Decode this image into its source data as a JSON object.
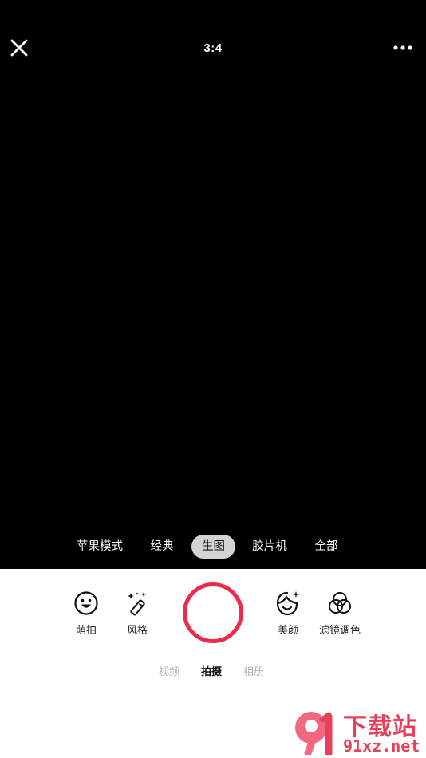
{
  "top_bar": {
    "ratio_label": "3:4"
  },
  "style_tabs": [
    {
      "label": "苹果模式",
      "active": false
    },
    {
      "label": "经典",
      "active": false
    },
    {
      "label": "生图",
      "active": true
    },
    {
      "label": "胶片机",
      "active": false
    },
    {
      "label": "全部",
      "active": false
    }
  ],
  "tools": {
    "cute": {
      "label": "萌拍",
      "icon": "smiley-face-icon"
    },
    "style": {
      "label": "风格",
      "icon": "magic-wand-icon"
    },
    "beauty": {
      "label": "美颜",
      "icon": "beauty-face-sparkle-icon"
    },
    "filter": {
      "label": "滤镜调色",
      "icon": "color-circles-icon"
    }
  },
  "modes": [
    {
      "label": "视频",
      "active": false
    },
    {
      "label": "拍摄",
      "active": true
    },
    {
      "label": "相册",
      "active": false
    }
  ],
  "watermark": {
    "brand": "下载站",
    "url": "91xz.net"
  },
  "colors": {
    "accent": "#f0284a",
    "viewfinder": "#000000",
    "active_tab_bg": "#d3d3d3"
  }
}
